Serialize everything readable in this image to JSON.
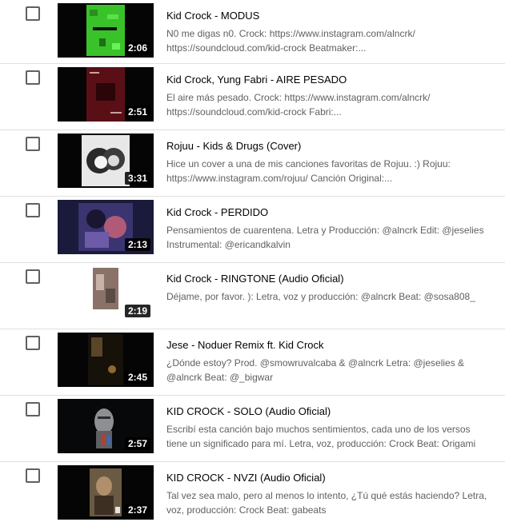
{
  "videos": [
    {
      "title": "Kid Crock - MODUS",
      "duration": "2:06",
      "description": "N0 me digas n0. Crock: https://www.instagram.com/alncrk/\nhttps://soundcloud.com/kid-crock Beatmaker:...",
      "thumbnail": "green-noise-artwork"
    },
    {
      "title": "Kid Crock, Yung Fabri - AIRE PESADO",
      "duration": "2:51",
      "description": "El aire más pesado. Crock: https://www.instagram.com/alncrk/\nhttps://soundcloud.com/kid-crock Fabri:...",
      "thumbnail": "dark-red-cover-artwork"
    },
    {
      "title": "Rojuu - Kids & Drugs (Cover)",
      "duration": "3:31",
      "description": "Hice un cover a una de mis canciones favoritas de Rojuu. :) Rojuu:\nhttps://www.instagram.com/rojuu/ Canción Original:...",
      "thumbnail": "anime-couple-artwork"
    },
    {
      "title": "Kid Crock - PERDIDO",
      "duration": "2:13",
      "description": "Pensamientos de cuarentena. Letra y Producción: @alncrk Edit: @jeselies\nInstrumental: @ericandkalvin",
      "thumbnail": "anime-purple-artwork"
    },
    {
      "title": "Kid Crock - RINGTONE (Audio Oficial)",
      "duration": "2:19",
      "description": "Déjame, por favor. ): Letra, voz y producción: @alncrk Beat: @sosa808_",
      "thumbnail": "vertical-photo"
    },
    {
      "title": "Jese - Noduer Remix ft. Kid Crock",
      "duration": "2:45",
      "description": "¿Dónde estoy? Prod. @smowruvalcaba & @alncrk Letra: @jeselies &\n@alncrk Beat: @_bigwar",
      "thumbnail": "dark-night-photo"
    },
    {
      "title": "KID CROCK - SOLO (Audio Oficial)",
      "duration": "2:57",
      "description": "Escribí esta canción bajo muchos sentimientos, cada uno de los versos\ntiene un significado para mí. Letra, voz, producción: Crock Beat: Origami",
      "thumbnail": "statue-glitch-artwork"
    },
    {
      "title": "KID CROCK - NVZI (Audio Oficial)",
      "duration": "2:37",
      "description": "Tal vez sea malo, pero al menos lo intento, ¿Tú qué estás haciendo? Letra,\nvoz, producción: Crock Beat: gabeats",
      "thumbnail": "portrait-artwork"
    }
  ]
}
